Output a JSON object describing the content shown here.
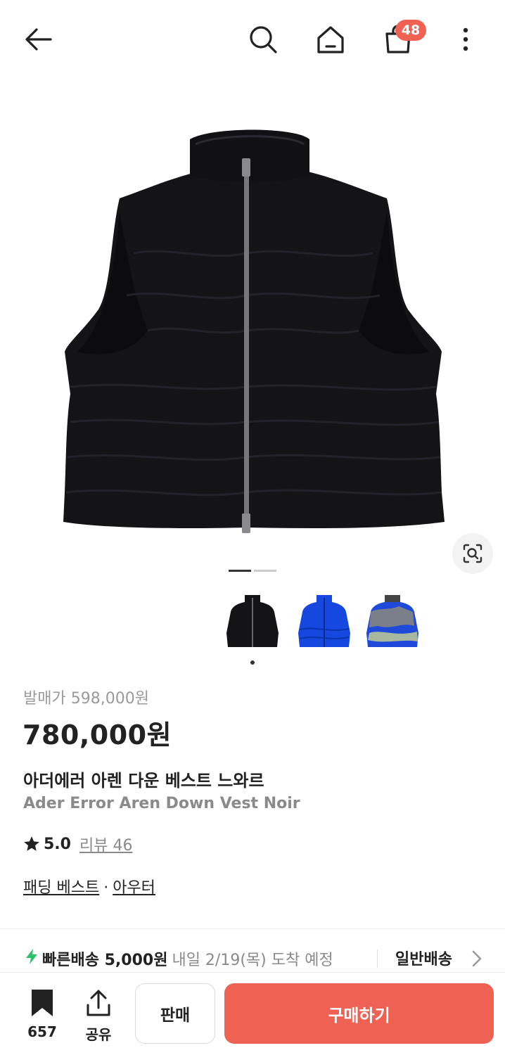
{
  "header": {
    "back_icon": "arrow-left-icon",
    "search_icon": "search-icon",
    "home_icon": "home-icon",
    "cart_icon": "shopping-bag-icon",
    "cart_count": "48",
    "more_icon": "more-vertical-icon"
  },
  "gallery": {
    "lens_icon": "image-search-icon",
    "page_count": 2,
    "current_page": 1,
    "thumbnail_colors": [
      "#111111",
      "#1648e0",
      "#5a6b8c"
    ]
  },
  "product": {
    "release_price_label": "발매가 598,000원",
    "price": "780,000원",
    "name_ko": "아더에러 아렌 다운 베스트 느와르",
    "name_en": "Ader Error Aren Down Vest Noir",
    "rating": "5.0",
    "reviews_label": "리뷰 46",
    "category_primary": "패딩 베스트",
    "category_separator": "·",
    "category_secondary": "아우터"
  },
  "delivery": {
    "fast_label": "빠른배송 5,000원",
    "fast_eta": "내일 2/19(목) 도착 예정",
    "normal_label": "일반배송"
  },
  "bottom_bar": {
    "bookmark_count": "657",
    "share_label": "공유",
    "sell_label": "판매",
    "buy_label": "구매하기"
  },
  "colors": {
    "accent": "#ef6253",
    "fast_delivery": "#2bc26b"
  }
}
